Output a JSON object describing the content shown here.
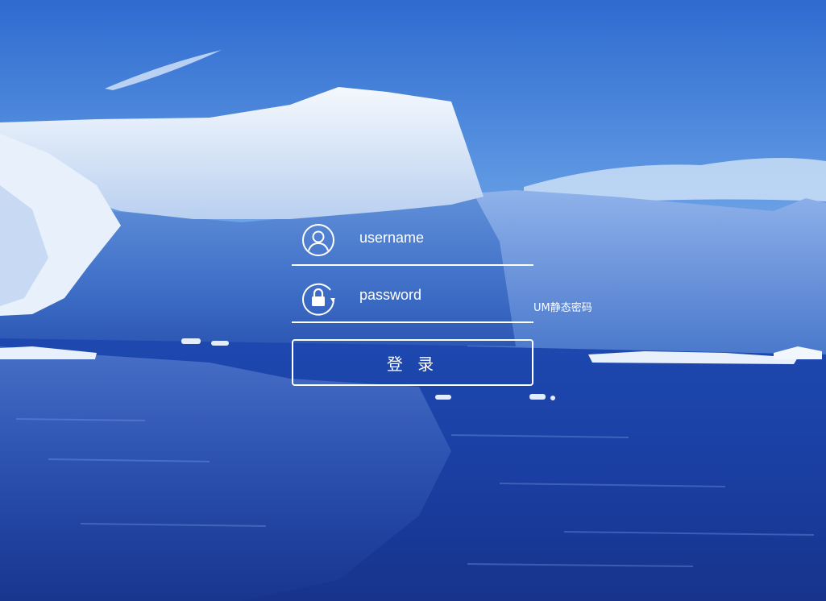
{
  "login": {
    "username_placeholder": "username",
    "password_placeholder": "password",
    "um_link": "UM静态密码",
    "submit_label": "登 录"
  },
  "background": {
    "subject": "iceberg-over-ocean",
    "sky_color": "#4a86d9",
    "water_color": "#1b3d9e",
    "ice_color": "#e9f1fb"
  },
  "icons": {
    "user": "user-circle-icon",
    "password": "lock-refresh-icon"
  }
}
